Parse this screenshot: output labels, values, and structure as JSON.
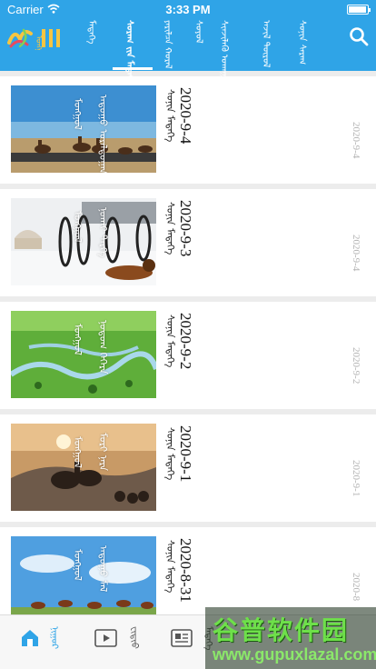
{
  "status_bar": {
    "carrier": "Carrier",
    "time": "3:33 PM"
  },
  "header": {
    "logo": "ᠮᠣᠩᠭᠣᠯ",
    "tabs": [
      {
        "label": "ᠮᠡᠳᠡᠭᠡ",
        "active": false
      },
      {
        "label": "ᠰᠤᠷᠠᠭ ᠵᠢᠨ ᠮᠡᠳᠡᠭᠡ",
        "active": true
      },
      {
        "label": "ᠶᠠᠷᠢᠯᠴᠠ ᠬᠣᠷᠠᠯ",
        "active": false
      },
      {
        "label": "ᠰᠣᠶᠣᠯ",
        "active": false
      },
      {
        "label": "ᠰᠢᠨᠵᠢᠯᠡᠬᠦ ᠤᠬᠠᠭᠠᠨ",
        "active": false
      },
      {
        "label": "ᠠᠵᠢᠯ ᠲᠥᠷᠥᠯ",
        "active": false
      },
      {
        "label": "ᠰᠣᠨᠢᠨ ᠰᠠᠷᠠᠭ",
        "active": false
      }
    ],
    "accent": "#2fa4e7"
  },
  "cards": [
    {
      "title": "2020-9-4",
      "subtitle": "ᠰᠣᠨᠢᠨ ᠮᠡᠳᠡᠭᠡ",
      "caption1": "ᠮᠣᠩᠭᠣᠯ",
      "caption2": "ᠠᠳᠤᠭᠤ ᠤᠷᠠᠯᠳᠤᠭᠠᠨ",
      "date": "2020-9-4",
      "scene": "horses"
    },
    {
      "title": "2020-9-3",
      "subtitle": "ᠰᠣᠨᠢᠨ ᠮᠡᠳᠡᠭᠡ",
      "caption1": "ᠮᠣᠩᠭᠣᠯ",
      "caption2": "ᠨᠣᠬᠠᠢ ᠲᠡᠷᠭᠡ",
      "date": "2020-9-4",
      "scene": "snow"
    },
    {
      "title": "2020-9-2",
      "subtitle": "ᠰᠣᠨᠢᠨ ᠮᠡᠳᠡᠭᠡ",
      "caption1": "ᠮᠣᠩᠭᠣᠯ",
      "caption2": "ᠨᠤᠲᠤᠭ ᠬᠡᠭᠡᠷᠡ",
      "date": "2020-9-2",
      "scene": "grass"
    },
    {
      "title": "2020-9-1",
      "subtitle": "ᠰᠣᠨᠢᠨ ᠮᠡᠳᠡᠭᠡ",
      "caption1": "ᠮᠣᠩᠭᠣᠯ",
      "caption2": "ᠮᠣᠷᠢ ᠨᠠᠷᠠ",
      "date": "2020-9-1",
      "scene": "sunset"
    },
    {
      "title": "2020-8-31",
      "subtitle": "ᠰᠣᠨᠢᠨ ᠮᠡᠳᠡᠭᠡ",
      "caption1": "ᠮᠣᠩᠭᠣᠯ",
      "caption2": "ᠠᠳᠤᠭᠤ ᠮᠠᠯ",
      "date": "2020-8",
      "scene": "sky"
    }
  ],
  "tabbar": [
    {
      "label": "ᠨᠢᠭᠤᠷ",
      "icon": "home-icon",
      "active": true
    },
    {
      "label": "ᠸᠢᠳᠢᠣ",
      "icon": "video-icon",
      "active": false
    },
    {
      "label": "ᠮᠡᠳᠡᠭᠡ",
      "icon": "news-icon",
      "active": false
    }
  ],
  "watermark": {
    "text": "谷普软件园",
    "url": "www.gupuxlazal.com"
  }
}
